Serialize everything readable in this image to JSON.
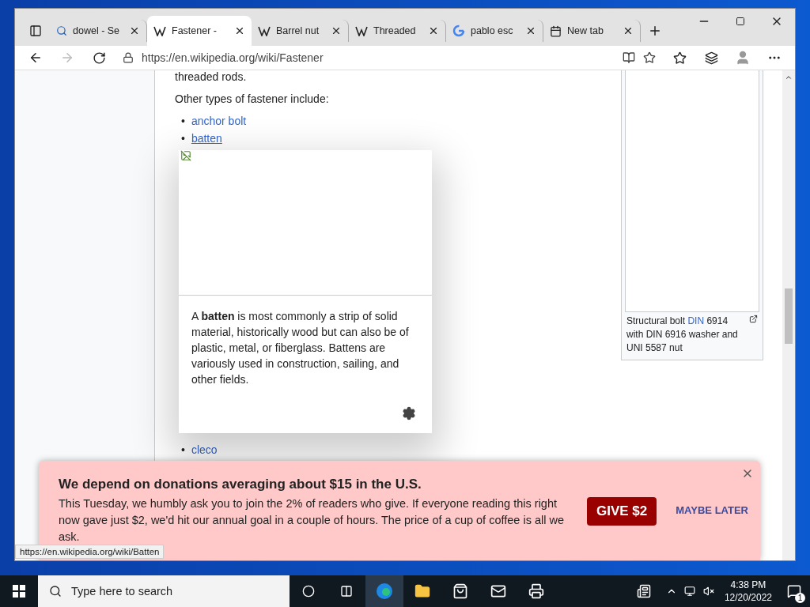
{
  "browser": {
    "tabs": [
      {
        "label": "dowel - Se",
        "kind": "search",
        "selected": false
      },
      {
        "label": "Fastener -",
        "kind": "wiki",
        "selected": true
      },
      {
        "label": "Barrel nut",
        "kind": "wiki",
        "selected": false
      },
      {
        "label": "Threaded",
        "kind": "wiki",
        "selected": false
      },
      {
        "label": "pablo esc",
        "kind": "google",
        "selected": false
      },
      {
        "label": "New tab",
        "kind": "newtab",
        "selected": false
      }
    ],
    "address": "https://en.wikipedia.org/wiki/Fastener"
  },
  "article": {
    "cut_line": "threaded rods.",
    "intro": "Other types of fastener include:",
    "list": [
      {
        "bullet": "•",
        "text": "anchor bolt",
        "hovered": false
      },
      {
        "bullet": "•",
        "text": "batten",
        "hovered": true
      },
      {
        "bullet": "•",
        "text": "cleco",
        "hovered": false
      }
    ],
    "infobox": {
      "caption_before": "Structural bolt ",
      "caption_link": "DIN",
      "caption_after": " 6914 with DIN 6916 washer and UNI 5587 nut"
    }
  },
  "preview": {
    "text": "A **batten** is most commonly a strip of solid material, historically wood but can also be of plastic, metal, or fiberglass. Battens are variously used in construction, sailing, and other fields."
  },
  "banner": {
    "title": "We depend on donations averaging about $15 in the U.S.",
    "body": "This Tuesday, we humbly ask you to join the 2% of readers who give. If everyone reading this right now gave just $2, we'd hit our annual goal in a couple of hours. The price of a cup of coffee is all we ask.",
    "give_button": "GIVE $2",
    "later_button": "MAYBE LATER"
  },
  "status_url": "https://en.wikipedia.org/wiki/Batten",
  "taskbar": {
    "search_placeholder": "Type here to search",
    "time": "4:38 PM",
    "date": "12/20/2022",
    "notifications": "1"
  }
}
